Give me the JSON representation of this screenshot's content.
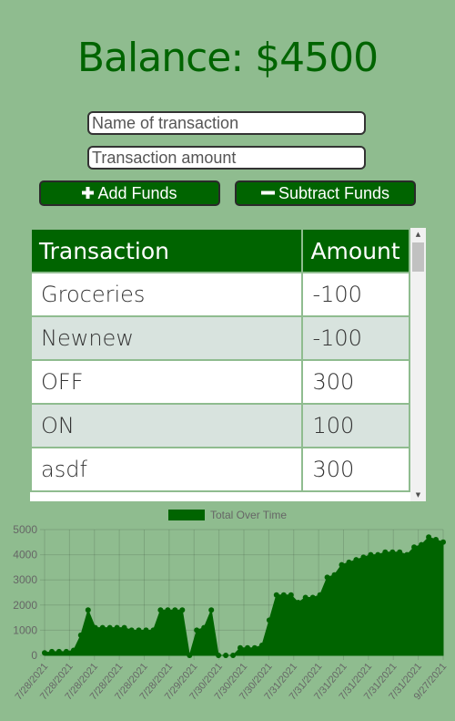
{
  "header": {
    "balance_text": "Balance: $4500"
  },
  "form": {
    "name_placeholder": "Name of transaction",
    "amount_placeholder": "Transaction amount",
    "add_label": "Add Funds",
    "subtract_label": "Subtract Funds",
    "add_icon": "plus-icon",
    "subtract_icon": "minus-icon"
  },
  "table": {
    "headers": [
      "Transaction",
      "Amount"
    ],
    "rows": [
      {
        "name": "Groceries",
        "amount": "-100"
      },
      {
        "name": "Newnew",
        "amount": "-100"
      },
      {
        "name": "OFF",
        "amount": "300"
      },
      {
        "name": "ON",
        "amount": "100"
      },
      {
        "name": "asdf",
        "amount": "300"
      }
    ]
  },
  "colors": {
    "background": "#8fbc8f",
    "accent": "#006400",
    "row_alt": "#d8e3de"
  },
  "chart_data": {
    "type": "area",
    "legend": "Total Over Time",
    "legend_position": "top",
    "ylim": [
      0,
      5000
    ],
    "yticks": [
      0,
      1000,
      2000,
      3000,
      4000,
      5000
    ],
    "grid": true,
    "xtick_labels": [
      "7/28/2021",
      "7/28/2021",
      "7/28/2021",
      "7/28/2021",
      "7/28/2021",
      "7/28/2021",
      "7/29/2021",
      "7/30/2021",
      "7/30/2021",
      "7/30/2021",
      "7/31/2021",
      "7/31/2021",
      "7/31/2021",
      "7/31/2021",
      "7/31/2021",
      "7/31/2021",
      "9/27/2021"
    ],
    "values": [
      100,
      150,
      150,
      150,
      200,
      800,
      1800,
      1100,
      1100,
      1100,
      1100,
      1100,
      1000,
      1000,
      1000,
      1000,
      1800,
      1800,
      1800,
      1800,
      0,
      1000,
      1100,
      1800,
      0,
      0,
      0,
      300,
      300,
      300,
      400,
      1400,
      2400,
      2400,
      2400,
      2100,
      2300,
      2300,
      2400,
      3100,
      3200,
      3600,
      3700,
      3800,
      3900,
      4000,
      4000,
      4100,
      4100,
      4100,
      4000,
      4300,
      4400,
      4700,
      4600,
      4500
    ]
  }
}
